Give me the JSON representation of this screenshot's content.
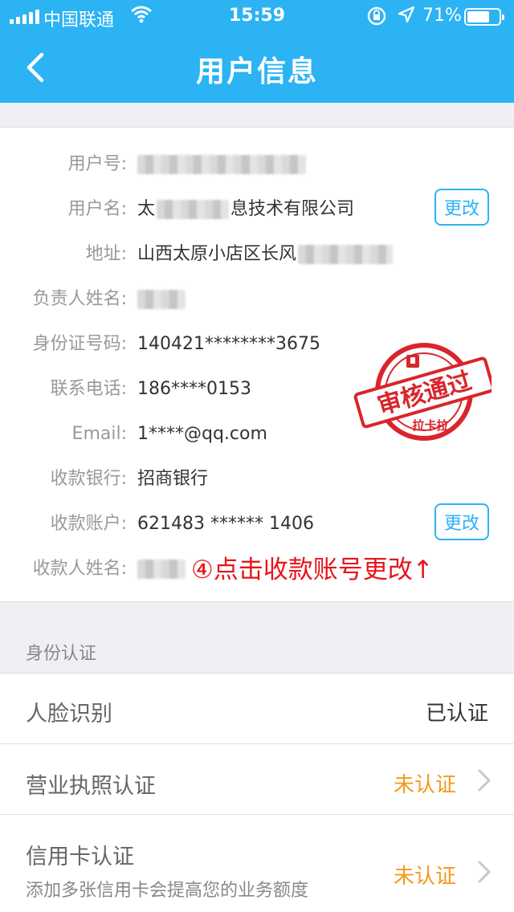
{
  "status_bar": {
    "carrier": "中国联通",
    "time": "15:59",
    "battery": "71%",
    "battery_level": 0.71
  },
  "nav": {
    "title": "用户信息"
  },
  "info": {
    "user_id_label": "用户号:",
    "username_label": "用户名:",
    "username_prefix": "太",
    "username_suffix": "息技术有限公司",
    "address_label": "地址:",
    "address_value": "山西太原小店区长风",
    "manager_label": "负责人姓名:",
    "id_label": "身份证号码:",
    "id_value": "140421********3675",
    "phone_label": "联系电话:",
    "phone_value": "186****0153",
    "email_label": "Email:",
    "email_value": "1****@qq.com",
    "bank_label": "收款银行:",
    "bank_value": "招商银行",
    "account_label": "收款账户:",
    "account_value": "621483 ****** 1406",
    "payee_label": "收款人姓名:",
    "change_label": "更改",
    "annotation": "④点击收款账号更改↑"
  },
  "stamp": {
    "main": "审核通过",
    "brand": "拉卡拉",
    "color": "#d9252c"
  },
  "identity": {
    "section_title": "身份认证",
    "items": [
      {
        "name": "人脸识别",
        "status": "已认证"
      },
      {
        "name": "营业执照认证",
        "status": "未认证"
      },
      {
        "name": "信用卡认证",
        "sub": "添加多张信用卡会提高您的业务额度",
        "status": "未认证"
      }
    ]
  },
  "colors": {
    "accent": "#2bb3f3",
    "warning": "#f39a1b",
    "annotation": "#e8131b"
  }
}
